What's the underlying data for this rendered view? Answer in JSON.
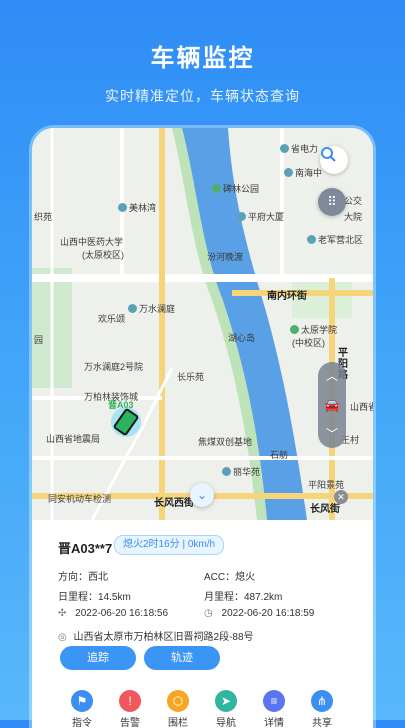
{
  "hero": {
    "title": "车辆监控",
    "subtitle": "实时精准定位，车辆状态查询"
  },
  "map": {
    "labels": {
      "meilinwan": "美林湾",
      "shengdianli": "省电力",
      "nanhaizhong": "南海中",
      "beilinpark": "碑林公园",
      "gongjiao": "公交",
      "zhiyuan": "织苑",
      "pinghuamansion": "平府大厦",
      "dayuan": "大院",
      "tcm_hospital": "山西中医药大学",
      "tcm_campus": "(太原校区)",
      "fenhe_wandu": "汾河晚渡",
      "laojun_temple": "老军营北区",
      "wanshuilanting": "万水澜庭",
      "nannei_road": "南内环街",
      "huanlesong": "欢乐颂",
      "huxindao": "湖心岛",
      "taiyuan_college": "太原学院",
      "taiyuan_college_campus": "(中校区)",
      "pingyang_road": "平阳路",
      "park_left": "园",
      "wanshuilanting2": "万水澜庭2号院",
      "changle": "长乐苑",
      "wanbailin_decor": "万柏林装饰城",
      "shanxi_sheng": "山西省",
      "car_plate_marker": "晋A03",
      "quake_bureau": "山西省地震局",
      "coal_base": "焦煤双创基地",
      "wangcun": "王村",
      "shifang": "石舫",
      "lidanyuan": "丽华苑",
      "pingyang_scenic": "平阳景苑",
      "tongan_inspection": "同安机动车检测",
      "changfengxi": "长风西街",
      "changfeng": "长风街"
    }
  },
  "vehicle": {
    "plate": "晋A03**7",
    "status": "熄火2时16分 | 0km/h",
    "direction": "方向：西北",
    "acc": "ACC：熄火",
    "daily_mileage": "日里程：14.5km",
    "monthly_mileage": "月里程：487.2km",
    "gps_time": "2022-06-20 16:18:56",
    "report_time": "2022-06-20 16:18:59",
    "address": "山西省太原市万柏林区旧晋祠路2段-88号"
  },
  "actions": {
    "track": "追踪",
    "trajectory": "轨迹"
  },
  "bottom_nav": [
    {
      "label": "指令",
      "color": "#3b8ef2"
    },
    {
      "label": "告警",
      "color": "#f2575b"
    },
    {
      "label": "围栏",
      "color": "#f5a623"
    },
    {
      "label": "导航",
      "color": "#2fb5a0"
    },
    {
      "label": "详情",
      "color": "#5b74f0"
    },
    {
      "label": "共享",
      "color": "#3b8ef2"
    }
  ]
}
